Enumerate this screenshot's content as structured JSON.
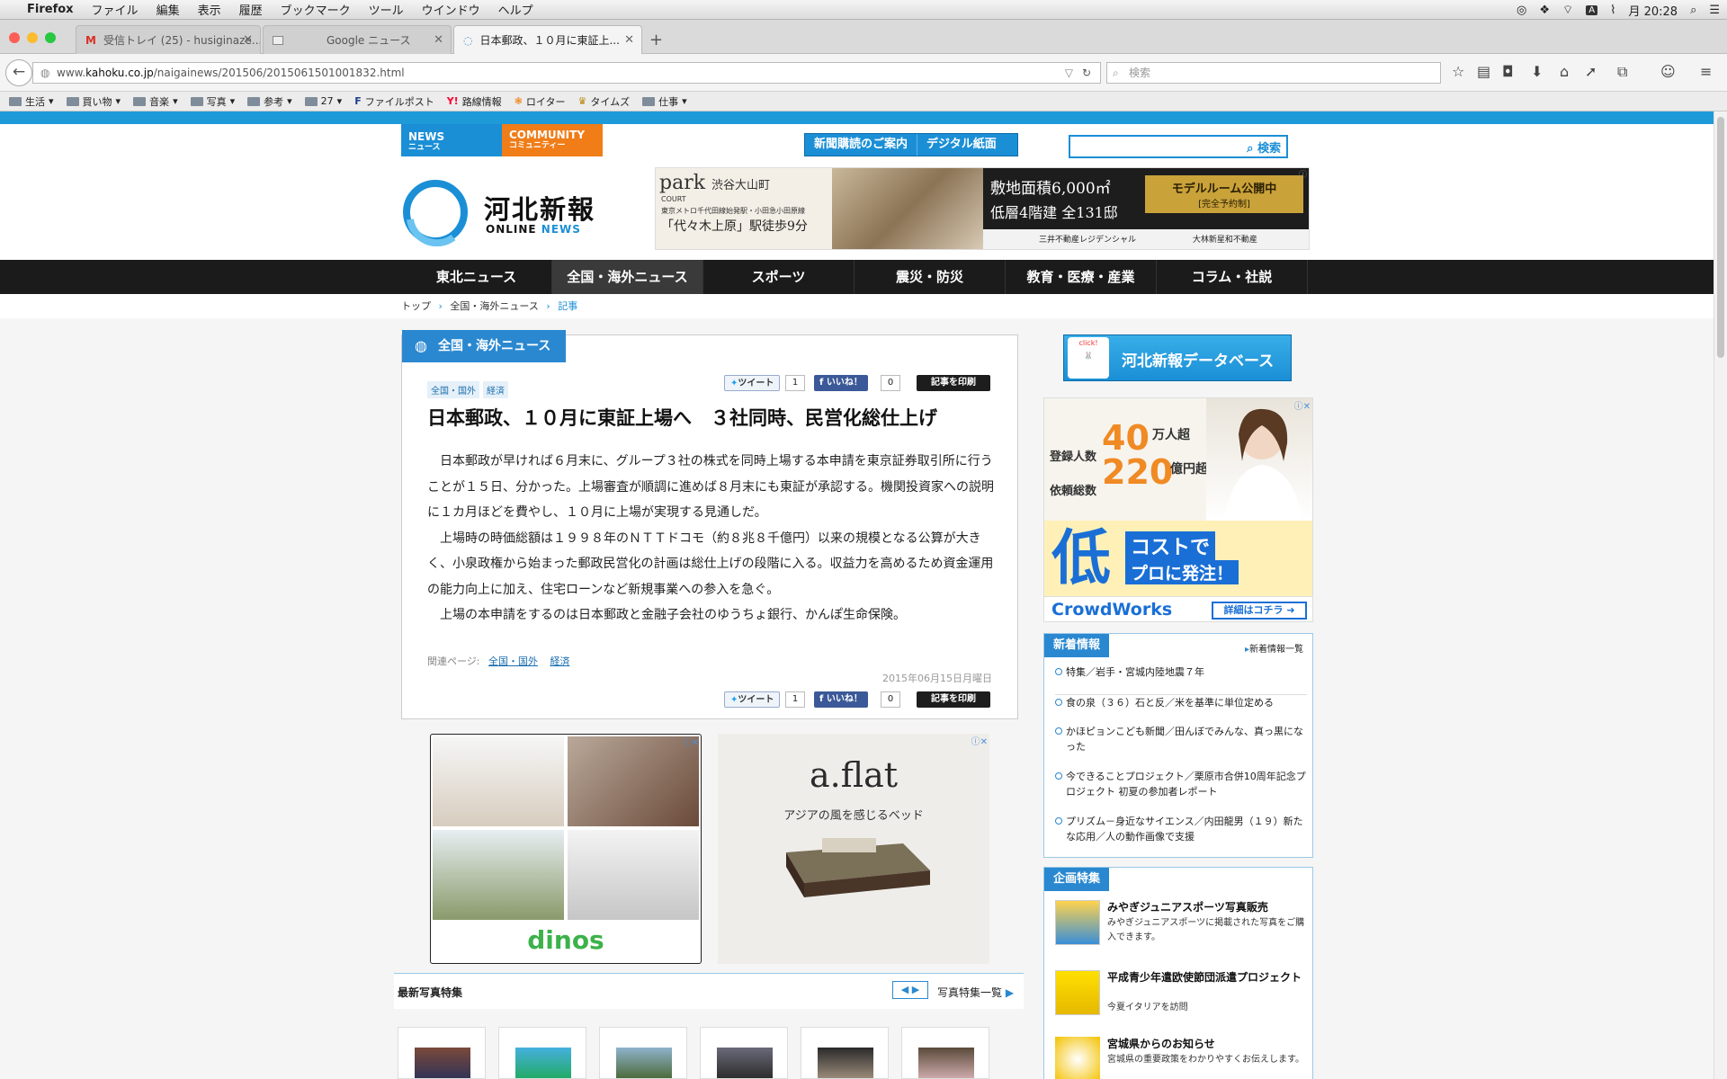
{
  "menubar": {
    "apple": "",
    "app": "Firefox",
    "items": [
      "ファイル",
      "編集",
      "表示",
      "履歴",
      "ブックマーク",
      "ツール",
      "ウインドウ",
      "ヘルプ"
    ],
    "clock": "月 20:28",
    "input_indicator": "A"
  },
  "tabs": [
    {
      "label": "受信トレイ (25) - husiginaze..."
    },
    {
      "label": "Google ニュース"
    },
    {
      "label": "日本郵政、１０月に東証上..."
    }
  ],
  "navbar": {
    "url_prefix": "www.",
    "url_domain": "kahoku.co.jp",
    "url_path": "/naigainews/201506/2015061501001832.html",
    "search_placeholder": "検索"
  },
  "bookmarks": [
    "生活",
    "買い物",
    "音楽",
    "写真",
    "参考",
    "27",
    "ファイルポスト",
    "路線情報",
    "ロイター",
    "タイムズ",
    "仕事"
  ],
  "site": {
    "tab_news_en": "NEWS",
    "tab_news_jp": "ニュース",
    "tab_community_en": "COMMUNITY",
    "tab_community_jp": "コミュニティー",
    "subscribe_label": "新聞購読のご案内",
    "digital_label": "デジタル紙面",
    "search_button": "検索",
    "logo_jp": "河北新報",
    "logo_online": "ONLINE",
    "logo_news": "NEWS",
    "nav": [
      "東北ニュース",
      "全国・海外ニュース",
      "スポーツ",
      "震災・防災",
      "教育・医療・産業",
      "コラム・社説"
    ],
    "breadcrumb": [
      "トップ",
      "全国・海外ニュース",
      "記事"
    ]
  },
  "top_ad": {
    "brand": "park",
    "brand_sub": "COURT",
    "place": "渋谷大山町",
    "station_line": "東京メトロ千代田線始発駅・小田急小田原線",
    "station": "「代々木上原」駅徒歩9分",
    "area": "敷地面積6,000㎡",
    "floors": "低層4階建 全131邸",
    "modelroom": "モデルルーム公開中",
    "reservation": "[完全予約制]",
    "seller1": "三井不動産レジデンシャル",
    "seller2": "大林新星和不動産"
  },
  "article": {
    "category": "全国・海外ニュース",
    "tags": [
      "全国・国外",
      "経済"
    ],
    "tweet_label": "ツイート",
    "tweet_count": "1",
    "like_label": "いいね！",
    "like_count": "0",
    "print_label": "記事を印刷",
    "title": "日本郵政、１０月に東証上場へ　３社同時、民営化総仕上げ",
    "paragraphs": [
      "日本郵政が早ければ６月末に、グループ３社の株式を同時上場する本申請を東京証券取引所に行うことが１５日、分かった。上場審査が順調に進めば８月末にも東証が承認する。機関投資家への説明に１カ月ほどを費やし、１０月に上場が実現する見通しだ。",
      "上場時の時価総額は１９９８年のＮＴＴドコモ（約８兆８千億円）以来の規模となる公算が大きく、小泉政権から始まった郵政民営化の計画は総仕上げの段階に入る。収益力を高めるため資金運用の能力向上に加え、住宅ローンなど新規事業への参入を急ぐ。",
      "上場の本申請をするのは日本郵政と金融子会社のゆうちょ銀行、かんぽ生命保険。"
    ],
    "related_label": "関連ページ:",
    "related": [
      "全国・国外",
      "経済"
    ],
    "date": "2015年06月15日月曜日"
  },
  "ads_below": {
    "dinos": "dinos",
    "aflat": "a.flat",
    "aflat_copy": "アジアの風を感じるベッド"
  },
  "photo_section": {
    "title": "最新写真特集",
    "list_link": "写真特集一覧"
  },
  "sidebar": {
    "database": "河北新報データベース",
    "click": "click!",
    "crowdworks": {
      "reg_label": "登録人数",
      "reg_value": "40",
      "reg_unit": "万人超",
      "total_label": "依頼総数",
      "total_value": "220",
      "total_unit": "億円超",
      "cost1": "低",
      "cost2": "コストで",
      "cost3": "プロに発注！",
      "brand": "CrowdWorks",
      "cta": "詳細はコチラ"
    },
    "news_title": "新着情報",
    "news_all": "新着情報一覧",
    "news": [
      "特集／岩手・宮城内陸地震７年",
      "食の泉（３６）石と反／米を基準に単位定める",
      "かほピョンこども新聞／田んぼでみんな、真っ黒になった",
      "今できることプロジェクト／栗原市合併10周年記念プロジェクト 初夏の参加者レポート",
      "プリズム－身近なサイエンス／内田龍男（１９）新たな応用／人の動作画像で支援"
    ],
    "kikaku_title": "企画特集",
    "kikaku": [
      {
        "title": "みやぎジュニアスポーツ写真販売",
        "desc": "みやぎジュニアスポーツに掲載された写真をご購入できます。"
      },
      {
        "title": "平成青少年遣欧使節団派遣プロジェクト",
        "desc": "今夏イタリアを訪問"
      },
      {
        "title": "宮城県からのお知らせ",
        "desc": "宮城県の重要政策をわかりやすくお伝えします。"
      }
    ]
  }
}
